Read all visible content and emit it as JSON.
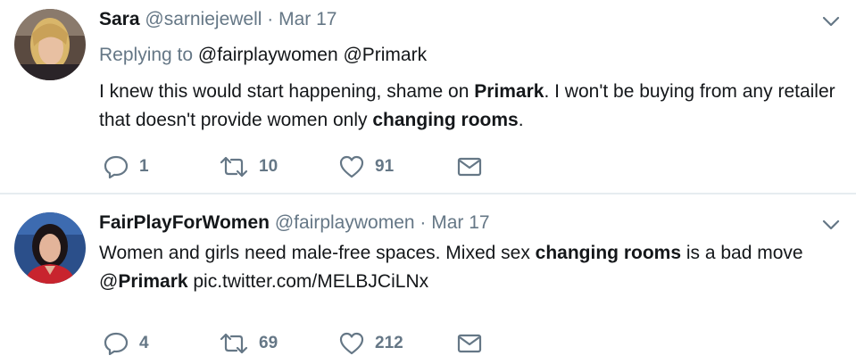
{
  "tweets": [
    {
      "name": "Sara",
      "handle": "@sarniejewell",
      "separator": "·",
      "date": "Mar 17",
      "replying_label": "Replying to",
      "replying_to": "@fairplaywomen @Primark",
      "text": {
        "p1": "I knew this would start happening, shame on ",
        "b1": "Primark",
        "p2": ". I won't be buying from any retailer that doesn't provide women only ",
        "b2": "changing rooms",
        "p3": "."
      },
      "replies": "1",
      "retweets": "10",
      "likes": "91"
    },
    {
      "name": "FairPlayForWomen",
      "handle": "@fairplaywomen",
      "separator": "·",
      "date": "Mar 17",
      "text": {
        "p1": "Women and girls need male-free spaces. Mixed sex ",
        "b1": "changing rooms",
        "p2": " is a bad move @",
        "b2": "Primark",
        "p3": " pic.twitter.com/MELBJCiLNx"
      },
      "replies": "4",
      "retweets": "69",
      "likes": "212"
    }
  ],
  "icons": {
    "reply": "reply-icon",
    "retweet": "retweet-icon",
    "like": "heart-icon",
    "dm": "envelope-icon",
    "more": "chevron-down-icon"
  },
  "colors": {
    "secondary_text": "#657786",
    "primary_text": "#14171a",
    "divider": "#e6ecf0"
  }
}
